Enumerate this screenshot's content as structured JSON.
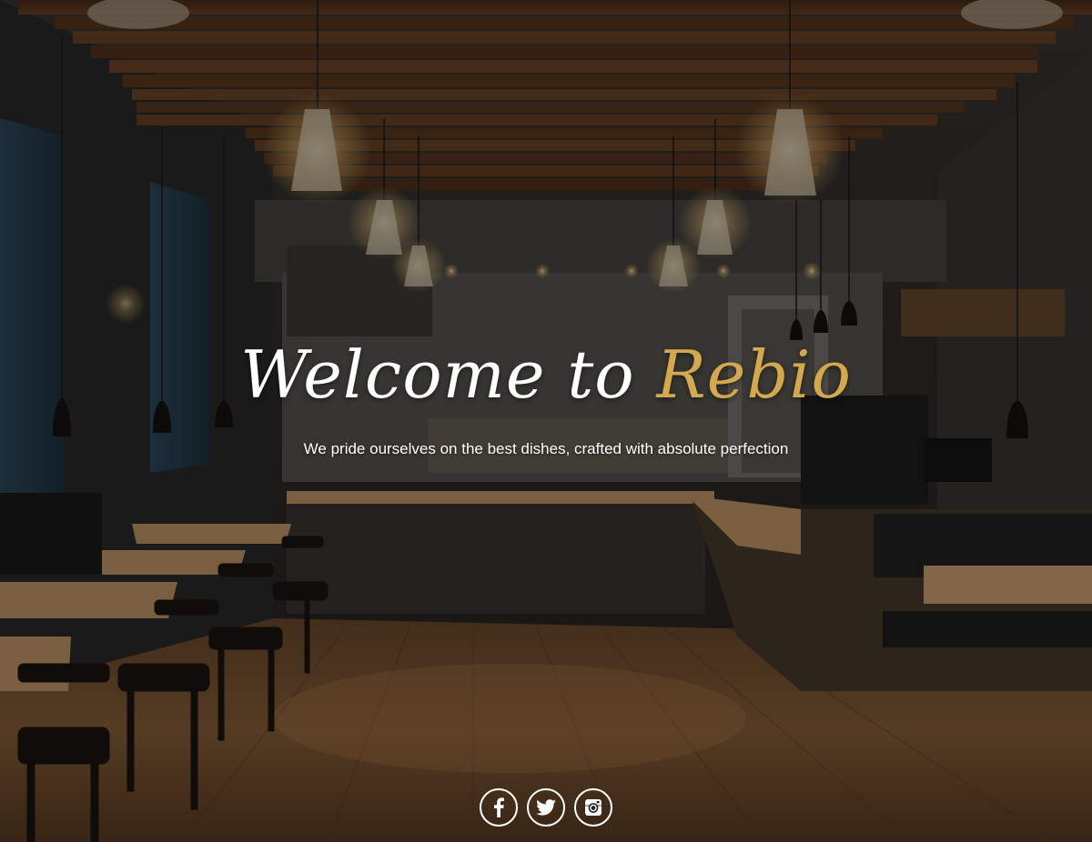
{
  "hero": {
    "title_prefix": "Welcome to ",
    "title_brand": "Rebio",
    "tagline": "We pride ourselves on the best dishes, crafted with absolute perfection",
    "brand_color": "#d4a84f",
    "background_image": "restaurant-interior"
  },
  "social": [
    {
      "icon": "facebook-icon",
      "label": "f"
    },
    {
      "icon": "twitter-icon",
      "label": "twitter"
    },
    {
      "icon": "instagram-icon",
      "label": "instagram"
    }
  ]
}
